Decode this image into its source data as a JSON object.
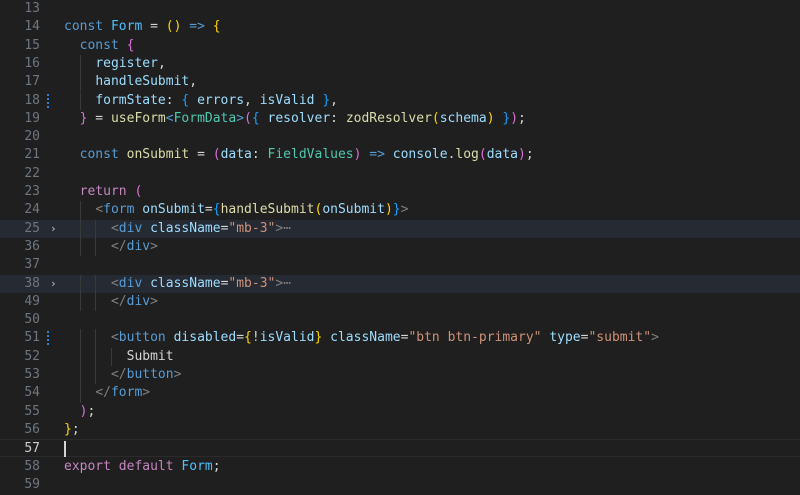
{
  "editor": {
    "lines": [
      {
        "num": "13",
        "tokens": []
      },
      {
        "num": "14",
        "tokens": [
          [
            "kw",
            "const"
          ],
          [
            "txt",
            " "
          ],
          [
            "const",
            "Form"
          ],
          [
            "txt",
            " = "
          ],
          [
            "br",
            "()"
          ],
          [
            "txt",
            " "
          ],
          [
            "kw",
            "=>"
          ],
          [
            "txt",
            " "
          ],
          [
            "br",
            "{"
          ]
        ]
      },
      {
        "num": "15",
        "indent": 1,
        "tokens": [
          [
            "kw",
            "const"
          ],
          [
            "txt",
            " "
          ],
          [
            "br2",
            "{"
          ]
        ]
      },
      {
        "num": "16",
        "indent": 2,
        "tokens": [
          [
            "id",
            "register"
          ],
          [
            "txt",
            ","
          ]
        ]
      },
      {
        "num": "17",
        "indent": 2,
        "tokens": [
          [
            "id",
            "handleSubmit"
          ],
          [
            "txt",
            ","
          ]
        ]
      },
      {
        "num": "18",
        "indent": 2,
        "marker": true,
        "tokens": [
          [
            "id",
            "formState"
          ],
          [
            "txt",
            ": "
          ],
          [
            "br3",
            "{"
          ],
          [
            "txt",
            " "
          ],
          [
            "id",
            "errors"
          ],
          [
            "txt",
            ", "
          ],
          [
            "id",
            "isValid"
          ],
          [
            "txt",
            " "
          ],
          [
            "br3",
            "}"
          ],
          [
            "txt",
            ","
          ]
        ]
      },
      {
        "num": "19",
        "indent": 1,
        "tokens": [
          [
            "br2",
            "}"
          ],
          [
            "txt",
            " = "
          ],
          [
            "fn",
            "useForm"
          ],
          [
            "tag",
            "<"
          ],
          [
            "type",
            "FormData"
          ],
          [
            "tag",
            ">"
          ],
          [
            "br2",
            "("
          ],
          [
            "br3",
            "{"
          ],
          [
            "txt",
            " "
          ],
          [
            "id",
            "resolver"
          ],
          [
            "txt",
            ": "
          ],
          [
            "fn",
            "zodResolver"
          ],
          [
            "br",
            "("
          ],
          [
            "id",
            "schema"
          ],
          [
            "br",
            ")"
          ],
          [
            "txt",
            " "
          ],
          [
            "br3",
            "}"
          ],
          [
            "br2",
            ")"
          ],
          [
            "txt",
            ";"
          ]
        ]
      },
      {
        "num": "20",
        "tokens": []
      },
      {
        "num": "21",
        "indent": 1,
        "tokens": [
          [
            "kw",
            "const"
          ],
          [
            "txt",
            " "
          ],
          [
            "fn",
            "onSubmit"
          ],
          [
            "txt",
            " = "
          ],
          [
            "br2",
            "("
          ],
          [
            "id",
            "data"
          ],
          [
            "txt",
            ": "
          ],
          [
            "type",
            "FieldValues"
          ],
          [
            "br2",
            ")"
          ],
          [
            "txt",
            " "
          ],
          [
            "kw",
            "=>"
          ],
          [
            "txt",
            " "
          ],
          [
            "id",
            "console"
          ],
          [
            "txt",
            "."
          ],
          [
            "fn",
            "log"
          ],
          [
            "br2",
            "("
          ],
          [
            "id",
            "data"
          ],
          [
            "br2",
            ")"
          ],
          [
            "txt",
            ";"
          ]
        ]
      },
      {
        "num": "22",
        "tokens": []
      },
      {
        "num": "23",
        "indent": 1,
        "tokens": [
          [
            "ctl",
            "return"
          ],
          [
            "txt",
            " "
          ],
          [
            "br2",
            "("
          ]
        ]
      },
      {
        "num": "24",
        "indent": 2,
        "tokens": [
          [
            "p",
            "<"
          ],
          [
            "tag",
            "form"
          ],
          [
            "txt",
            " "
          ],
          [
            "id",
            "onSubmit"
          ],
          [
            "txt",
            "="
          ],
          [
            "br3",
            "{"
          ],
          [
            "fn",
            "handleSubmit"
          ],
          [
            "br",
            "("
          ],
          [
            "id",
            "onSubmit"
          ],
          [
            "br",
            ")"
          ],
          [
            "br3",
            "}"
          ],
          [
            "p",
            ">"
          ]
        ]
      },
      {
        "num": "25",
        "indent": 3,
        "fold": true,
        "hl": true,
        "tokens": [
          [
            "p",
            "<"
          ],
          [
            "tag",
            "div"
          ],
          [
            "txt",
            " "
          ],
          [
            "id",
            "className"
          ],
          [
            "txt",
            "="
          ],
          [
            "str",
            "\"mb-3\""
          ],
          [
            "p",
            ">"
          ],
          [
            "p",
            "⋯"
          ]
        ]
      },
      {
        "num": "36",
        "indent": 3,
        "tokens": [
          [
            "p",
            "</"
          ],
          [
            "tag",
            "div"
          ],
          [
            "p",
            ">"
          ]
        ]
      },
      {
        "num": "37",
        "tokens": []
      },
      {
        "num": "38",
        "indent": 3,
        "fold": true,
        "hl": true,
        "tokens": [
          [
            "p",
            "<"
          ],
          [
            "tag",
            "div"
          ],
          [
            "txt",
            " "
          ],
          [
            "id",
            "className"
          ],
          [
            "txt",
            "="
          ],
          [
            "str",
            "\"mb-3\""
          ],
          [
            "p",
            ">"
          ],
          [
            "p",
            "⋯"
          ]
        ]
      },
      {
        "num": "49",
        "indent": 3,
        "tokens": [
          [
            "p",
            "</"
          ],
          [
            "tag",
            "div"
          ],
          [
            "p",
            ">"
          ]
        ]
      },
      {
        "num": "50",
        "tokens": []
      },
      {
        "num": "51",
        "indent": 3,
        "marker": true,
        "tokens": [
          [
            "p",
            "<"
          ],
          [
            "tag",
            "button"
          ],
          [
            "txt",
            " "
          ],
          [
            "id",
            "disabled"
          ],
          [
            "txt",
            "="
          ],
          [
            "br",
            "{"
          ],
          [
            "txt",
            "!"
          ],
          [
            "id",
            "isValid"
          ],
          [
            "br",
            "}"
          ],
          [
            "txt",
            " "
          ],
          [
            "id",
            "className"
          ],
          [
            "txt",
            "="
          ],
          [
            "str",
            "\"btn btn-primary\""
          ],
          [
            "txt",
            " "
          ],
          [
            "id",
            "type"
          ],
          [
            "txt",
            "="
          ],
          [
            "str",
            "\"submit\""
          ],
          [
            "p",
            ">"
          ]
        ]
      },
      {
        "num": "52",
        "indent": 4,
        "tokens": [
          [
            "txt",
            "Submit"
          ]
        ]
      },
      {
        "num": "53",
        "indent": 3,
        "tokens": [
          [
            "p",
            "</"
          ],
          [
            "tag",
            "button"
          ],
          [
            "p",
            ">"
          ]
        ]
      },
      {
        "num": "54",
        "indent": 2,
        "tokens": [
          [
            "p",
            "</"
          ],
          [
            "tag",
            "form"
          ],
          [
            "p",
            ">"
          ]
        ]
      },
      {
        "num": "55",
        "indent": 1,
        "tokens": [
          [
            "br2",
            ")"
          ],
          [
            "txt",
            ";"
          ]
        ]
      },
      {
        "num": "56",
        "tokens": [
          [
            "br",
            "}"
          ],
          [
            "txt",
            ";"
          ]
        ]
      },
      {
        "num": "57",
        "cursor": true,
        "tokens": []
      },
      {
        "num": "58",
        "tokens": [
          [
            "ctl",
            "export"
          ],
          [
            "txt",
            " "
          ],
          [
            "ctl",
            "default"
          ],
          [
            "txt",
            " "
          ],
          [
            "const",
            "Form"
          ],
          [
            "txt",
            ";"
          ]
        ]
      },
      {
        "num": "59",
        "tokens": []
      }
    ]
  }
}
